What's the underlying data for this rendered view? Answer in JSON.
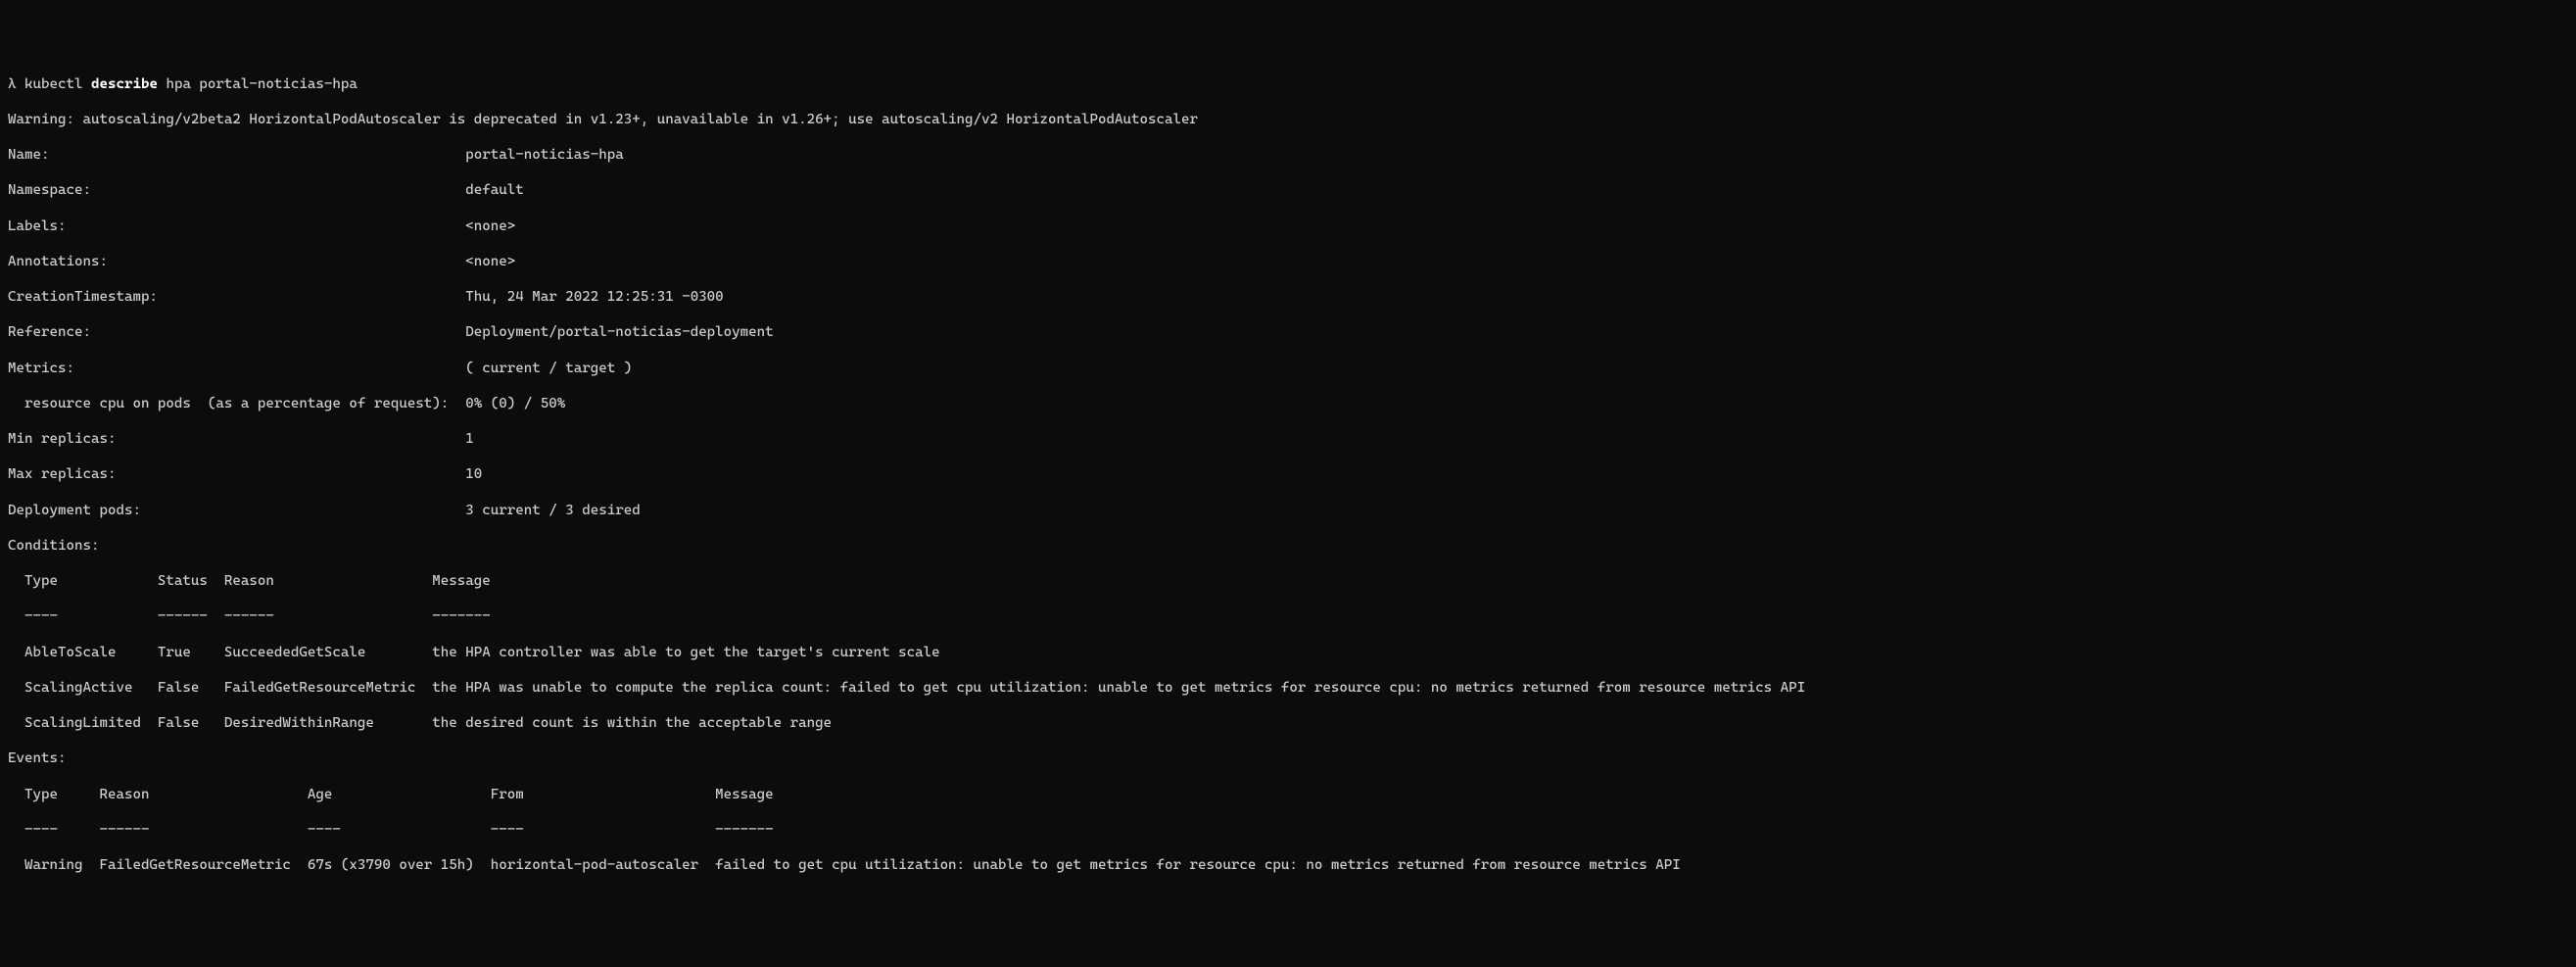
{
  "prompt_symbol": "λ",
  "command": "kubectl",
  "command_bold": "describe",
  "command_args": " hpa portal-noticias-hpa",
  "warning": "Warning: autoscaling/v2beta2 HorizontalPodAutoscaler is deprecated in v1.23+, unavailable in v1.26+; use autoscaling/v2 HorizontalPodAutoscaler",
  "fields": {
    "name_label": "Name:",
    "name_value": "portal-noticias-hpa",
    "namespace_label": "Namespace:",
    "namespace_value": "default",
    "labels_label": "Labels:",
    "labels_value": "<none>",
    "annotations_label": "Annotations:",
    "annotations_value": "<none>",
    "creation_label": "CreationTimestamp:",
    "creation_value": "Thu, 24 Mar 2022 12:25:31 -0300",
    "reference_label": "Reference:",
    "reference_value": "Deployment/portal-noticias-deployment",
    "metrics_label": "Metrics:",
    "metrics_value": "( current / target )",
    "metrics_detail_label": "  resource cpu on pods  (as a percentage of request):",
    "metrics_detail_value": "0% (0) / 50%",
    "min_replicas_label": "Min replicas:",
    "min_replicas_value": "1",
    "max_replicas_label": "Max replicas:",
    "max_replicas_value": "10",
    "deployment_pods_label": "Deployment pods:",
    "deployment_pods_value": "3 current / 3 desired"
  },
  "conditions": {
    "header": "Conditions:",
    "col_headers": "  Type            Status  Reason                   Message",
    "col_dashes": "  ----            ------  ------                   -------",
    "rows": [
      "  AbleToScale     True    SucceededGetScale        the HPA controller was able to get the target's current scale",
      "  ScalingActive   False   FailedGetResourceMetric  the HPA was unable to compute the replica count: failed to get cpu utilization: unable to get metrics for resource cpu: no metrics returned from resource metrics API",
      "  ScalingLimited  False   DesiredWithinRange       the desired count is within the acceptable range"
    ]
  },
  "events": {
    "header": "Events:",
    "col_headers": "  Type     Reason                   Age                   From                       Message",
    "col_dashes": "  ----     ------                   ----                  ----                       -------",
    "rows": [
      "  Warning  FailedGetResourceMetric  67s (x3790 over 15h)  horizontal-pod-autoscaler  failed to get cpu utilization: unable to get metrics for resource cpu: no metrics returned from resource metrics API"
    ]
  }
}
